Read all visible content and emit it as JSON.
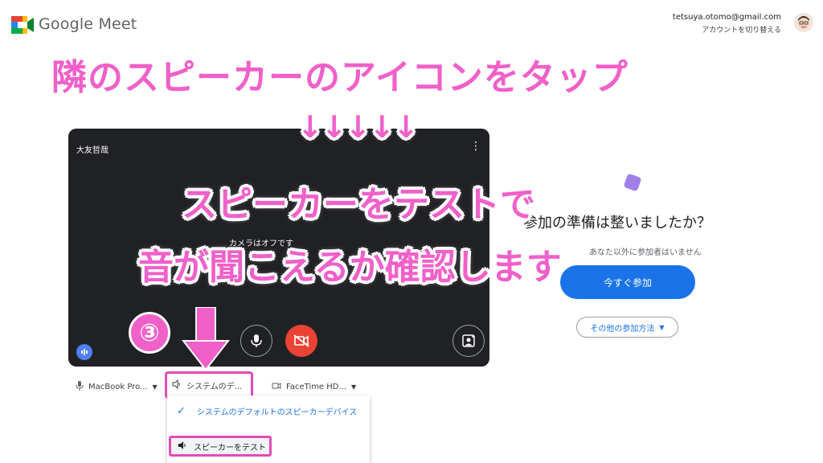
{
  "header": {
    "brand": "Google Meet",
    "account_email": "tetsuya.otomo@gmail.com",
    "switch_account": "アカウントを切り替える"
  },
  "preview": {
    "user_name": "大友哲哉",
    "camera_status": "カメラはオフです"
  },
  "devices": {
    "microphone": "MacBook Pro...",
    "speaker": "システムのデ...",
    "camera": "FaceTime HD..."
  },
  "speaker_menu": {
    "option_default": "システムのデフォルトのスピーカーデバイス",
    "option_test": "スピーカーをテスト"
  },
  "right_panel": {
    "ready_title": "参加の準備は整いましたか？",
    "no_one_text": "あなた以外に参加者はいません",
    "join_label": "今すぐ参加",
    "other_join_label": "その他の参加方法"
  },
  "annotations": {
    "top": "隣のスピーカーのアイコンをタップ",
    "arrows": "↓↓↓↓↓",
    "middle_line1": "スピーカーをテストで",
    "middle_line2": "音が聞こえるか確認します",
    "step": "③"
  },
  "colors": {
    "accent_pink": "#f060c9",
    "meet_blue": "#1a73e8",
    "camera_red": "#ea4335",
    "preview_bg": "#202124"
  }
}
